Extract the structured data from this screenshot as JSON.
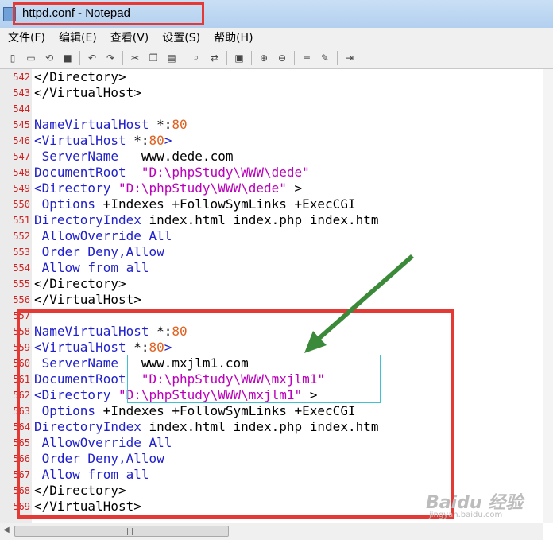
{
  "window": {
    "title": "httpd.conf - Notepad"
  },
  "menu": [
    "文件(F)",
    "编辑(E)",
    "查看(V)",
    "设置(S)",
    "帮助(H)"
  ],
  "toolbar": {
    "groups": [
      [
        "new-file-icon",
        "open-file-icon",
        "reload-icon",
        "save-icon"
      ],
      [
        "undo-icon",
        "redo-icon"
      ],
      [
        "cut-icon",
        "copy-icon",
        "paste-icon"
      ],
      [
        "find-icon",
        "replace-icon"
      ],
      [
        "go-to-icon"
      ],
      [
        "zoom-in-icon",
        "zoom-out-icon"
      ],
      [
        "word-wrap-icon",
        "edit-icon"
      ],
      [
        "exit-icon"
      ]
    ]
  },
  "colors": {
    "line_number": "#cc2222",
    "directive": "#2020cc",
    "string": "#bb00bb",
    "number": "#e06020",
    "annotation_box": "#e53935",
    "arrow": "#3a8a3a"
  },
  "lines": [
    {
      "num": "542",
      "code": "</Directory>",
      "type": "tag"
    },
    {
      "num": "543",
      "code": "</VirtualHost>",
      "type": "tag"
    },
    {
      "num": "544",
      "code": "",
      "type": "blank"
    },
    {
      "num": "545",
      "code": "NameVirtualHost *:80",
      "type": "namevh"
    },
    {
      "num": "546",
      "code": "<VirtualHost *:80>",
      "type": "vh"
    },
    {
      "num": "547",
      "code": " ServerName   www.dede.com",
      "type": "servername"
    },
    {
      "num": "548",
      "code": "DocumentRoot  \"D:\\phpStudy\\WWW\\dede\"",
      "type": "docroot"
    },
    {
      "num": "549",
      "code": "<Directory \"D:\\phpStudy\\WWW\\dede\" >",
      "type": "dir"
    },
    {
      "num": "550",
      "code": " Options +Indexes +FollowSymLinks +ExecCGI",
      "type": "options"
    },
    {
      "num": "551",
      "code": "DirectoryIndex index.html index.php index.htm",
      "type": "dirindex"
    },
    {
      "num": "552",
      "code": " AllowOverride All",
      "type": "plain"
    },
    {
      "num": "553",
      "code": " Order Deny,Allow",
      "type": "plain"
    },
    {
      "num": "554",
      "code": " Allow from all",
      "type": "plain"
    },
    {
      "num": "555",
      "code": "</Directory>",
      "type": "tag"
    },
    {
      "num": "556",
      "code": "</VirtualHost>",
      "type": "tag"
    },
    {
      "num": "557",
      "code": "",
      "type": "blank"
    },
    {
      "num": "558",
      "code": "NameVirtualHost *:80",
      "type": "namevh"
    },
    {
      "num": "559",
      "code": "<VirtualHost *:80>",
      "type": "vh"
    },
    {
      "num": "560",
      "code": " ServerName   www.mxjlm1.com",
      "type": "servername"
    },
    {
      "num": "561",
      "code": "DocumentRoot  \"D:\\phpStudy\\WWW\\mxjlm1\"",
      "type": "docroot"
    },
    {
      "num": "562",
      "code": "<Directory \"D:\\phpStudy\\WWW\\mxjlm1\" >",
      "type": "dir"
    },
    {
      "num": "563",
      "code": " Options +Indexes +FollowSymLinks +ExecCGI",
      "type": "options"
    },
    {
      "num": "564",
      "code": "DirectoryIndex index.html index.php index.htm",
      "type": "dirindex"
    },
    {
      "num": "565",
      "code": " AllowOverride All",
      "type": "plain"
    },
    {
      "num": "566",
      "code": " Order Deny,Allow",
      "type": "plain"
    },
    {
      "num": "567",
      "code": " Allow from all",
      "type": "plain"
    },
    {
      "num": "568",
      "code": "</Directory>",
      "type": "tag"
    },
    {
      "num": "569",
      "code": "</VirtualHost>",
      "type": "tag"
    }
  ],
  "watermark": {
    "main": "Baidu 经验",
    "sub": "jingyan.baidu.com"
  }
}
